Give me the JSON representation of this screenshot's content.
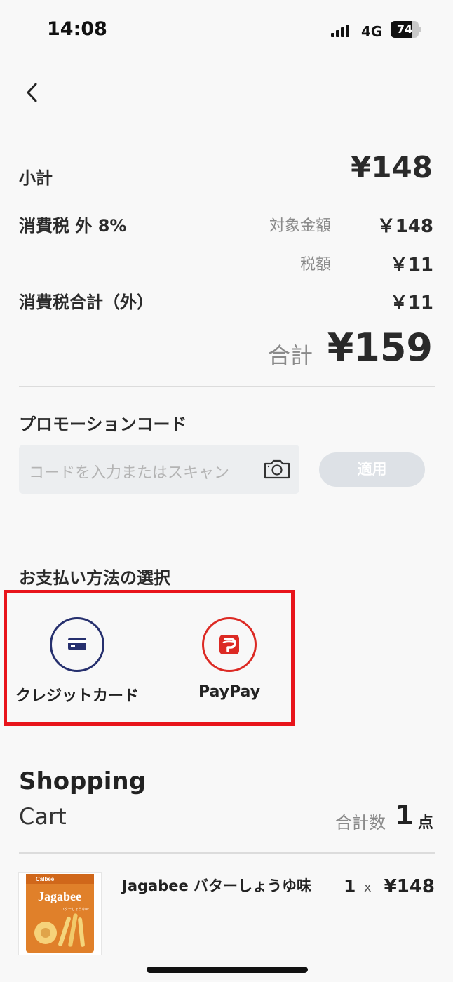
{
  "status_bar": {
    "time": "14:08",
    "network": "4G",
    "battery_percent": 74,
    "battery_label": "74"
  },
  "summary": {
    "subtotal_label": "小計",
    "subtotal_value": "¥148",
    "tax_label": "消費税 外 8%",
    "taxable_label": "対象金額",
    "taxable_value": "￥148",
    "tax_amount_label": "税額",
    "tax_amount_value": "￥11",
    "tax_total_label": "消費税合計（外）",
    "tax_total_value": "￥11",
    "total_label": "合計",
    "total_value": "¥159"
  },
  "promo": {
    "title": "プロモーションコード",
    "placeholder": "コードを入力またはスキャン",
    "apply_label": "適用"
  },
  "payment": {
    "title": "お支払い方法の選択",
    "options": [
      {
        "label": "クレジットカード",
        "icon": "credit-card-icon",
        "color": "#26306e"
      },
      {
        "label": "PayPay",
        "icon": "paypay-icon",
        "color": "#dc2a24"
      }
    ]
  },
  "cart": {
    "title": "Shopping",
    "subtitle": "Cart",
    "count_label": "合計数",
    "count": "1",
    "count_unit": "点",
    "items": [
      {
        "name": "Jagabee バターしょうゆ味",
        "quantity": "1",
        "times": "x",
        "price": "¥148",
        "brand": "Calbee",
        "product_logo": "Jagabee",
        "package_text": "バターしょうゆ味"
      }
    ]
  }
}
